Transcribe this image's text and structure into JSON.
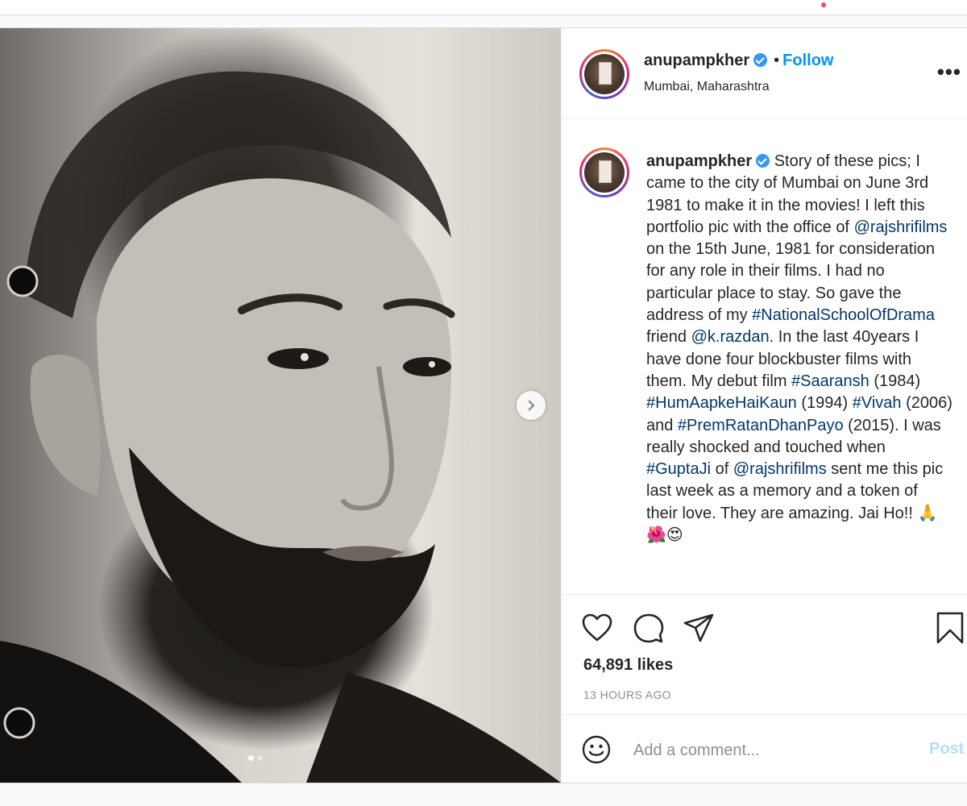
{
  "post": {
    "username": "anupampkher",
    "follow_label": "Follow",
    "separator": "•",
    "location": "Mumbai, Maharashtra",
    "more_label": "•••",
    "caption_parts": [
      {
        "type": "text",
        "value": " Story of these pics; I came to the city of Mumbai on June 3rd 1981 to make it in the movies! I left this portfolio pic with the office of "
      },
      {
        "type": "link",
        "value": "@rajshrifilms"
      },
      {
        "type": "text",
        "value": " on the 15th June, 1981 for consideration for any role in their films. I had no particular place to stay. So gave the address of my "
      },
      {
        "type": "link",
        "value": "#NationalSchoolOfDrama"
      },
      {
        "type": "text",
        "value": " friend "
      },
      {
        "type": "link",
        "value": "@k.razdan"
      },
      {
        "type": "text",
        "value": ". In the last 40years I have done four blockbuster films with them. My debut film "
      },
      {
        "type": "link",
        "value": "#Saaransh"
      },
      {
        "type": "text",
        "value": " (1984) "
      },
      {
        "type": "link",
        "value": "#HumAapkeHaiKaun"
      },
      {
        "type": "text",
        "value": " (1994) "
      },
      {
        "type": "link",
        "value": "#Vivah"
      },
      {
        "type": "text",
        "value": " (2006) and "
      },
      {
        "type": "link",
        "value": "#PremRatanDhanPayo"
      },
      {
        "type": "text",
        "value": " (2015). I was really shocked and touched when "
      },
      {
        "type": "link",
        "value": "#GuptaJi"
      },
      {
        "type": "text",
        "value": " of "
      },
      {
        "type": "link",
        "value": "@rajshrifilms"
      },
      {
        "type": "text",
        "value": " sent me this pic last week as a memory and a token of their love. They are amazing. Jai Ho!! 🙏🌺😍"
      }
    ],
    "likes": "64,891 likes",
    "timestamp": "13 HOURS AGO",
    "comment_placeholder": "Add a comment...",
    "post_label": "Post",
    "carousel": {
      "count": 2,
      "active_index": 0
    },
    "icons": {
      "like": "heart-icon",
      "comment": "comment-icon",
      "share": "paper-plane-icon",
      "save": "bookmark-icon",
      "emoji": "smiley-icon",
      "next": "chevron-right-icon",
      "verified": "verified-badge-icon"
    },
    "colors": {
      "link": "#00376b",
      "follow": "#0095f6",
      "post_disabled": "#b2dffc",
      "muted": "#8e8e8e",
      "verified": "#3897f0"
    }
  }
}
